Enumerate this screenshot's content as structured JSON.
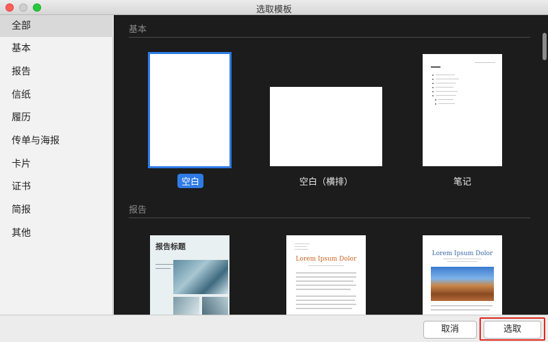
{
  "window": {
    "title": "选取模板"
  },
  "sidebar": {
    "items": [
      {
        "label": "全部",
        "selected": true
      },
      {
        "label": "基本",
        "selected": false
      },
      {
        "label": "报告",
        "selected": false
      },
      {
        "label": "信纸",
        "selected": false
      },
      {
        "label": "履历",
        "selected": false
      },
      {
        "label": "传单与海报",
        "selected": false
      },
      {
        "label": "卡片",
        "selected": false
      },
      {
        "label": "证书",
        "selected": false
      },
      {
        "label": "简报",
        "selected": false
      },
      {
        "label": "其他",
        "selected": false
      }
    ]
  },
  "gallery": {
    "sections": [
      {
        "title": "基本",
        "templates": [
          {
            "label": "空白",
            "selected": true
          },
          {
            "label": "空白（横排）",
            "selected": false
          },
          {
            "label": "笔记",
            "selected": false
          }
        ]
      },
      {
        "title": "报告",
        "templates": [
          {
            "label": "",
            "thumb_title": "报告标题"
          },
          {
            "label": "",
            "thumb_title": "Lorem Ipsum Dolor"
          },
          {
            "label": "",
            "thumb_title": "Lorem Ipsum Dolor"
          }
        ]
      }
    ]
  },
  "footer": {
    "cancel_label": "取消",
    "choose_label": "选取"
  },
  "colors": {
    "accent": "#2f7be6",
    "gallery_bg": "#1c1c1c",
    "highlight": "#e0281e"
  }
}
